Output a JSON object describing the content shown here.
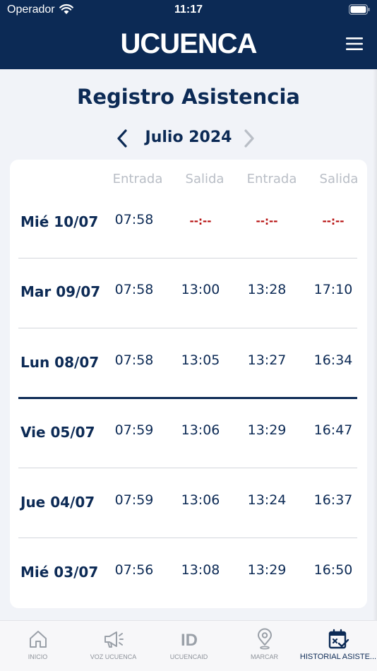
{
  "status_bar": {
    "carrier": "Operador",
    "time": "11:17"
  },
  "header": {
    "logo": "UCUENCA"
  },
  "page": {
    "title": "Registro Asistencia",
    "month": "Julio 2024"
  },
  "columns": [
    "Entrada",
    "Salida",
    "Entrada",
    "Salida"
  ],
  "rows": [
    {
      "day": "Mié 10/07",
      "times": [
        "07:58",
        "--:--",
        "--:--",
        "--:--"
      ]
    },
    {
      "day": "Mar 09/07",
      "times": [
        "07:58",
        "13:00",
        "13:28",
        "17:10"
      ]
    },
    {
      "day": "Lun 08/07",
      "times": [
        "07:58",
        "13:05",
        "13:27",
        "16:34"
      ]
    },
    {
      "day": "Vie 05/07",
      "times": [
        "07:59",
        "13:06",
        "13:29",
        "16:47"
      ]
    },
    {
      "day": "Jue 04/07",
      "times": [
        "07:59",
        "13:06",
        "13:24",
        "16:37"
      ]
    },
    {
      "day": "Mié 03/07",
      "times": [
        "07:56",
        "13:08",
        "13:29",
        "16:50"
      ]
    }
  ],
  "tabs": [
    {
      "label": "INICIO",
      "icon": "home-icon"
    },
    {
      "label": "VOZ UCUENCA",
      "icon": "megaphone-icon"
    },
    {
      "label": "UCUENCAID",
      "icon": "id-icon"
    },
    {
      "label": "MARCAR",
      "icon": "location-pin-icon"
    },
    {
      "label": "HISTORIAL ASISTE...",
      "icon": "calendar-check-icon",
      "active": true
    }
  ],
  "colors": {
    "brand": "#0c2a55",
    "empty_time": "#b50d0d",
    "inactive": "#8d929a"
  }
}
